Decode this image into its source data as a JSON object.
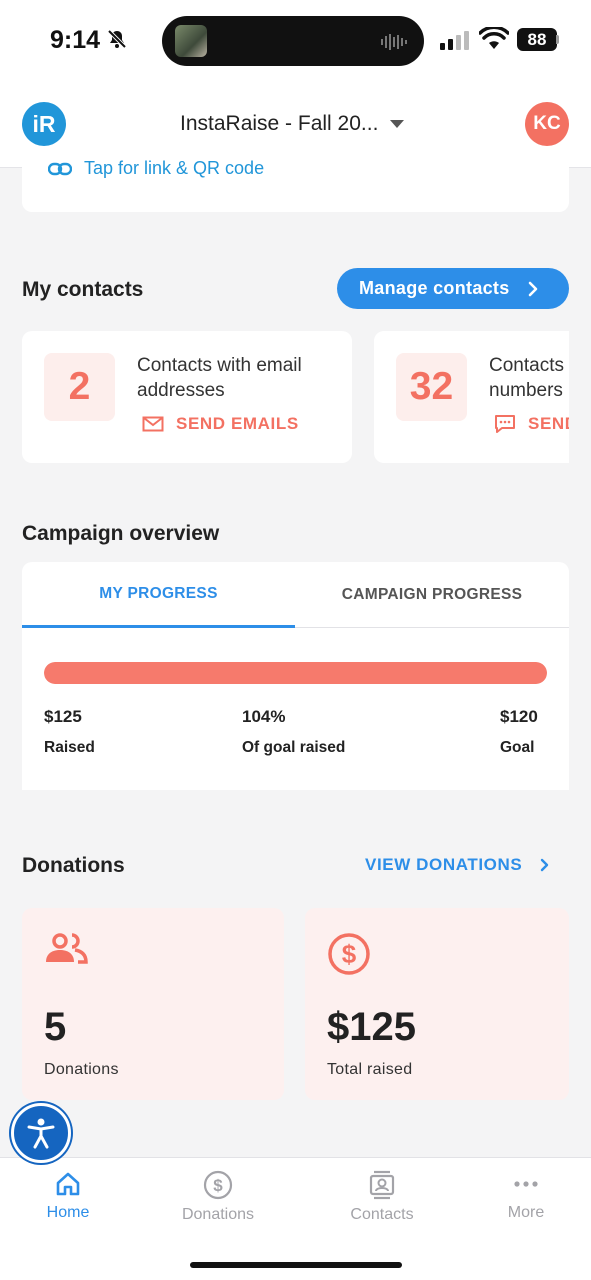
{
  "status_bar": {
    "time": "9:14",
    "battery": "88"
  },
  "header": {
    "logo": "iR",
    "campaign": "InstaRaise - Fall 20...",
    "avatar_initials": "KC"
  },
  "top_card": {
    "link_text": "Tap for link & QR code"
  },
  "contacts": {
    "title": "My contacts",
    "manage_label": "Manage contacts",
    "cards": [
      {
        "count": "2",
        "text": "Contacts with email addresses",
        "action": "SEND EMAILS",
        "icon": "mail-icon"
      },
      {
        "count": "32",
        "text": "Contacts with phone numbers",
        "action": "SEND TEXTS",
        "icon": "message-icon"
      }
    ]
  },
  "overview": {
    "title": "Campaign overview",
    "tabs": [
      {
        "label": "MY PROGRESS",
        "active": true
      },
      {
        "label": "CAMPAIGN PROGRESS",
        "active": false
      }
    ],
    "progress_fraction": 1.0,
    "stats": [
      {
        "value": "$125",
        "label": "Raised"
      },
      {
        "value": "104%",
        "label": "Of goal raised"
      },
      {
        "value": "$120",
        "label": "Goal"
      }
    ]
  },
  "donations": {
    "title": "Donations",
    "view_label": "VIEW DONATIONS",
    "cards": [
      {
        "value": "5",
        "label": "Donations",
        "icon": "people-icon"
      },
      {
        "value": "$125",
        "label": "Total raised",
        "icon": "dollar-circle-icon"
      }
    ]
  },
  "nav": {
    "items": [
      {
        "label": "Home",
        "icon": "home-icon",
        "active": true
      },
      {
        "label": "Donations",
        "icon": "dollar-circle-icon",
        "active": false
      },
      {
        "label": "Contacts",
        "icon": "contacts-icon",
        "active": false
      },
      {
        "label": "More",
        "icon": "more-icon",
        "active": false
      }
    ]
  },
  "colors": {
    "accent": "#2d8ee8",
    "coral": "#f37162",
    "coral_tint": "#fdf0ef",
    "background": "#f4f4f5"
  }
}
